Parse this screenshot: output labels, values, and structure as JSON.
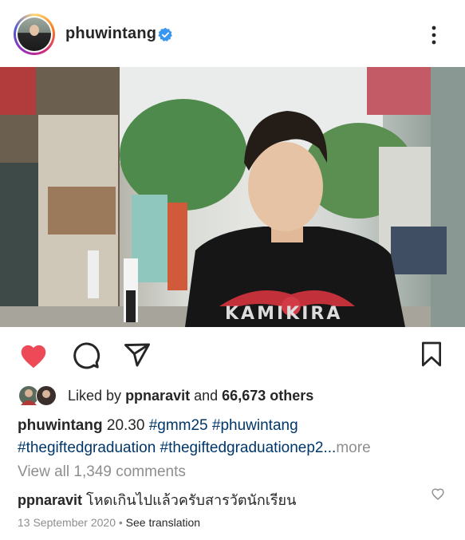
{
  "post": {
    "username": "phuwintang",
    "verified_icon": "verified-badge-icon",
    "more_icon": "more-options-icon"
  },
  "actions": {
    "like_icon": "heart-filled-icon",
    "comment_icon": "comment-icon",
    "share_icon": "send-icon",
    "save_icon": "bookmark-icon"
  },
  "likes": {
    "prefix": "Liked by",
    "user": "ppnaravit",
    "and": "and",
    "others": "66,673 others"
  },
  "caption": {
    "username": "phuwintang",
    "text": "20.30",
    "tags_line1": [
      "#gmm25",
      "#phuwintang"
    ],
    "tags_line2": [
      "#thegiftedgraduation",
      "#thegiftedgraduationep2..."
    ],
    "more": "more"
  },
  "view_comments": "View all 1,349 comments",
  "comment": {
    "username": "ppnaravit",
    "text": "โหดเกินไปแล้วครับสารวัตนักเรียน"
  },
  "meta": {
    "date": "13 September 2020",
    "separator": "•",
    "see_translation": "See translation"
  },
  "colors": {
    "like_red": "#ed4956",
    "verified_blue": "#3897f0",
    "hashtag": "#00376b",
    "muted": "#8e8e8e"
  }
}
